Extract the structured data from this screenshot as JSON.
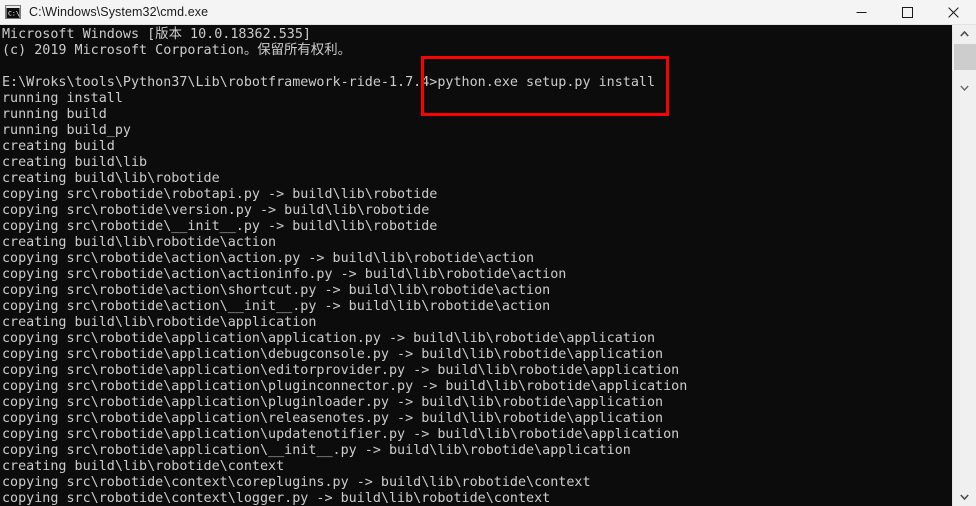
{
  "window": {
    "title": "C:\\Windows\\System32\\cmd.exe",
    "icon": "cmd-console-icon",
    "colors": {
      "titlebar_bg": "#f4f4f4",
      "titlebar_fg": "#1a1a1a",
      "console_bg": "#0c0c0c",
      "console_fg": "#cccccc",
      "annotation": "#fe0000",
      "scrollbar_track": "#f0f0f0",
      "scrollbar_thumb": "#cdcdcd"
    },
    "controls": {
      "minimize_label": "—",
      "maximize_label": "☐",
      "close_label": "✕"
    }
  },
  "annotation": {
    "shape": "rectangle",
    "color": "#fe0000",
    "highlighted_text": "python.exe setup.py install"
  },
  "scrollbar": {
    "up_arrow": "∧",
    "down_arrow": "∨",
    "mid_mark": "∨",
    "thumb_position_percent": 4
  },
  "console": {
    "banner": [
      "Microsoft Windows [版本 10.0.18362.535]",
      "(c) 2019 Microsoft Corporation。保留所有权利。"
    ],
    "prompt": "E:\\Wroks\\tools\\Python37\\Lib\\robotframework-ride-1.7.4>",
    "command": "python.exe setup.py install",
    "lines": [
      "Microsoft Windows [版本 10.0.18362.535]",
      "(c) 2019 Microsoft Corporation。保留所有权利。",
      "",
      "E:\\Wroks\\tools\\Python37\\Lib\\robotframework-ride-1.7.4>python.exe setup.py install",
      "running install",
      "running build",
      "running build_py",
      "creating build",
      "creating build\\lib",
      "creating build\\lib\\robotide",
      "copying src\\robotide\\robotapi.py -> build\\lib\\robotide",
      "copying src\\robotide\\version.py -> build\\lib\\robotide",
      "copying src\\robotide\\__init__.py -> build\\lib\\robotide",
      "creating build\\lib\\robotide\\action",
      "copying src\\robotide\\action\\action.py -> build\\lib\\robotide\\action",
      "copying src\\robotide\\action\\actioninfo.py -> build\\lib\\robotide\\action",
      "copying src\\robotide\\action\\shortcut.py -> build\\lib\\robotide\\action",
      "copying src\\robotide\\action\\__init__.py -> build\\lib\\robotide\\action",
      "creating build\\lib\\robotide\\application",
      "copying src\\robotide\\application\\application.py -> build\\lib\\robotide\\application",
      "copying src\\robotide\\application\\debugconsole.py -> build\\lib\\robotide\\application",
      "copying src\\robotide\\application\\editorprovider.py -> build\\lib\\robotide\\application",
      "copying src\\robotide\\application\\pluginconnector.py -> build\\lib\\robotide\\application",
      "copying src\\robotide\\application\\pluginloader.py -> build\\lib\\robotide\\application",
      "copying src\\robotide\\application\\releasenotes.py -> build\\lib\\robotide\\application",
      "copying src\\robotide\\application\\updatenotifier.py -> build\\lib\\robotide\\application",
      "copying src\\robotide\\application\\__init__.py -> build\\lib\\robotide\\application",
      "creating build\\lib\\robotide\\context",
      "copying src\\robotide\\context\\coreplugins.py -> build\\lib\\robotide\\context",
      "copying src\\robotide\\context\\logger.py -> build\\lib\\robotide\\context"
    ]
  }
}
